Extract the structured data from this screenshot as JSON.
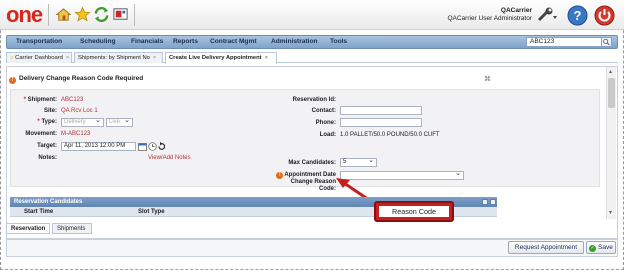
{
  "header": {
    "logo": "one",
    "user_line1": "QACarrier",
    "user_line2": "QACarrier User Administrator"
  },
  "nav": {
    "items": [
      "Transportation",
      "Scheduling",
      "Financials",
      "Reports",
      "Contract Mgmt",
      "Administration",
      "Tools"
    ],
    "search_value": "ABC123"
  },
  "tabs": [
    {
      "label": "Carrier Dashboard"
    },
    {
      "label": "Shipments: by Shipment No"
    },
    {
      "label": "Create Live Delivery Appointment"
    }
  ],
  "panel": {
    "title": "Delivery Change Reason Code Required",
    "collapse_icon": "⌘"
  },
  "form": {
    "shipment_label": "Shipment:",
    "shipment_value": "ABC123",
    "site_label": "Site:",
    "site_value": "QA Rcv Loc 1",
    "type_label": "Type:",
    "type_value1": "Delivery",
    "type_value2": "Live",
    "movement_label": "Movement:",
    "movement_value": "M-ABC123",
    "target_label": "Target:",
    "target_value": "Apr 11, 2013 12:00 PM",
    "notes_label": "Notes:",
    "notes_link": "View/Add Notes",
    "reservation_label": "Reservation Id:",
    "contact_label": "Contact:",
    "phone_label": "Phone:",
    "load_label": "Load:",
    "load_value": "1.0 PALLET/50.0 POUND/50.0 CUFT",
    "max_label": "Max Candidates:",
    "max_value": "5",
    "reason_label": "Appointment Date Change Reason Code:"
  },
  "candidates": {
    "title": "Reservation Candidates",
    "col_start": "Start Time",
    "col_slot": "Slot Type"
  },
  "bottom_tabs": [
    "Reservation",
    "Shipments"
  ],
  "footer": {
    "request_label": "Request Appointment",
    "save_label": "Save"
  },
  "callout": {
    "text": "Reason Code"
  }
}
